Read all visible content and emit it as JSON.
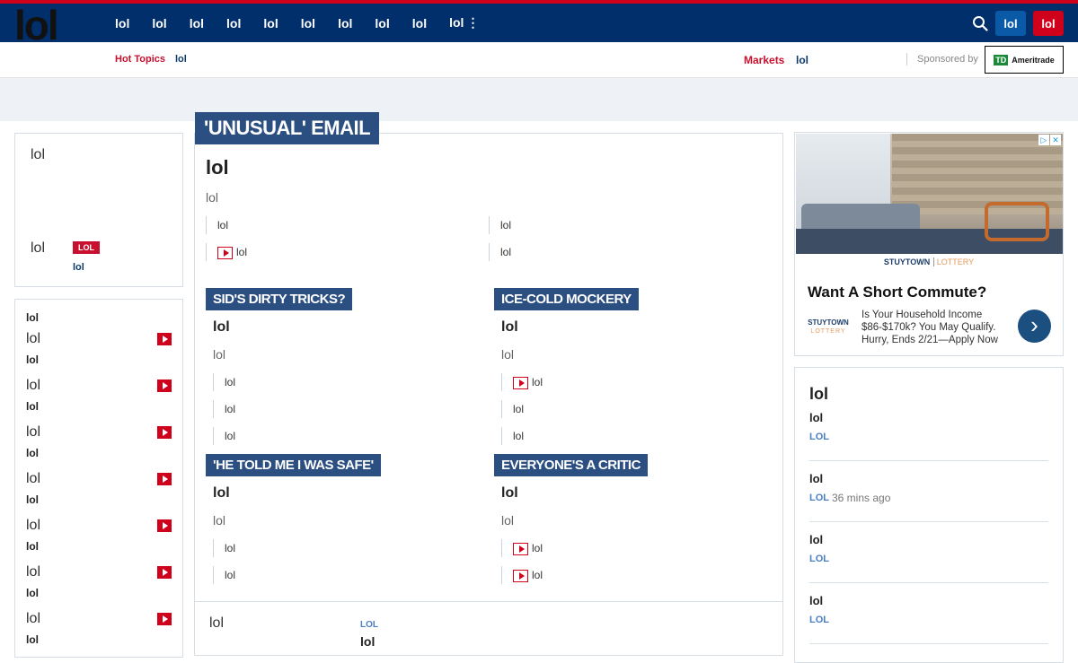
{
  "logo": "lol",
  "nav": {
    "items": [
      "lol",
      "lol",
      "lol",
      "lol",
      "lol",
      "lol",
      "lol",
      "lol",
      "lol",
      "lol"
    ],
    "more_icon": "⋮",
    "btn_blue": "lol",
    "btn_red": "lol"
  },
  "subnav": {
    "hot_topics": "Hot Topics",
    "hot_link": "lol",
    "markets": "Markets",
    "markets_link": "lol",
    "sponsored_by": "Sponsored by",
    "sponsor_mark": "TD",
    "sponsor_name": "Ameritrade"
  },
  "left_top": {
    "text1": "lol",
    "text2": "lol",
    "badge": "LOL",
    "badge_sub": "lol"
  },
  "left_list": {
    "heading": "lol",
    "items": [
      {
        "title": "lol",
        "sub": "lol"
      },
      {
        "title": "lol",
        "sub": "lol"
      },
      {
        "title": "lol",
        "sub": "lol"
      },
      {
        "title": "lol",
        "sub": "lol"
      },
      {
        "title": "lol",
        "sub": "lol"
      },
      {
        "title": "lol",
        "sub": "lol"
      },
      {
        "title": "lol",
        "sub": "lol"
      }
    ]
  },
  "main": {
    "lead_kicker": "'UNUSUAL' EMAIL",
    "lead_kicker_bg": "lol",
    "lead_headline": "lol",
    "lead_sub": "lol",
    "lead_bullets": [
      "lol",
      "lol",
      "lol",
      "lol"
    ],
    "stories": [
      {
        "kicker": "SID'S DIRTY TRICKS?",
        "kicker_bg": "lol",
        "headline": "lol",
        "sub": "lol",
        "bullets": [
          "lol",
          "lol",
          "lol"
        ]
      },
      {
        "kicker": "ICE-COLD MOCKERY",
        "kicker_bg": "lol",
        "headline": "lol",
        "sub": "lol",
        "bullets": [
          "lol",
          "lol",
          "lol"
        ]
      },
      {
        "kicker": "'HE TOLD ME I WAS SAFE'",
        "kicker_bg": "lol",
        "headline": "lol",
        "sub": "lol",
        "bullets": [
          "lol",
          "lol"
        ]
      },
      {
        "kicker": "EVERYONE'S A CRITIC",
        "kicker_bg": "lol",
        "headline": "lol",
        "sub": "lol",
        "bullets": [
          "lol",
          "lol"
        ]
      }
    ],
    "bottom_left": "lol",
    "bottom_tag": "LOL",
    "bottom_headline": "lol"
  },
  "ad": {
    "brand": "STUYTOWN",
    "brand_suffix": "LOTTERY",
    "headline": "Want A Short Commute?",
    "logo_top": "STUYTOWN",
    "logo_bottom": "LOTTERY",
    "body": "Is Your Household Income $86-$170k? You May Qualify. Hurry, Ends 2/21—Apply Now",
    "arrow_icon": "›",
    "adchoice": "▷",
    "close": "✕"
  },
  "right_list": {
    "heading": "lol",
    "items": [
      {
        "title": "lol",
        "tag": "LOL",
        "time": ""
      },
      {
        "title": "lol",
        "tag": "LOL",
        "time": "36 mins ago"
      },
      {
        "title": "lol",
        "tag": "LOL",
        "time": ""
      },
      {
        "title": "lol",
        "tag": "LOL",
        "time": ""
      }
    ]
  }
}
